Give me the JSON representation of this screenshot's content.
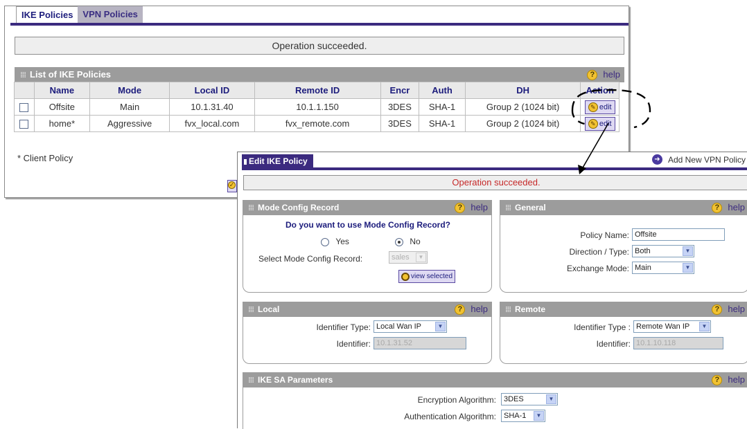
{
  "back": {
    "tabs": [
      "IKE Policies",
      "VPN Policies"
    ],
    "status": "Operation succeeded.",
    "section_title": "List of IKE Policies",
    "help": "help",
    "columns": [
      "Name",
      "Mode",
      "Local ID",
      "Remote ID",
      "Encr",
      "Auth",
      "DH",
      "Action"
    ],
    "rows": [
      {
        "name": "Offsite",
        "mode": "Main",
        "local_id": "10.1.31.40",
        "remote_id": "10.1.1.150",
        "encr": "3DES",
        "auth": "SHA-1",
        "dh": "Group 2 (1024 bit)",
        "action": "edit"
      },
      {
        "name": "home*",
        "mode": "Aggressive",
        "local_id": "fvx_local.com",
        "remote_id": "fvx_remote.com",
        "encr": "3DES",
        "auth": "SHA-1",
        "dh": "Group 2 (1024 bit)",
        "action": "edit"
      }
    ],
    "footnote": "* Client Policy"
  },
  "front": {
    "tab": "Edit IKE Policy",
    "add_new": "Add New VPN Policy",
    "status": "Operation succeeded.",
    "help": "help",
    "mode_config": {
      "title": "Mode Config Record",
      "question": "Do you want to use Mode Config Record?",
      "yes": "Yes",
      "no": "No",
      "selected": "No",
      "select_label": "Select Mode Config Record:",
      "select_value": "sales",
      "view_button": "view selected"
    },
    "general": {
      "title": "General",
      "policy_name_label": "Policy Name:",
      "policy_name_value": "Offsite",
      "direction_label": "Direction / Type:",
      "direction_value": "Both",
      "exchange_label": "Exchange Mode:",
      "exchange_value": "Main"
    },
    "local": {
      "title": "Local",
      "id_type_label": "Identifier Type:",
      "id_type_value": "Local Wan IP",
      "id_label": "Identifier:",
      "id_value": "10.1.31.52"
    },
    "remote": {
      "title": "Remote",
      "id_type_label": "Identifier Type :",
      "id_type_value": "Remote Wan IP",
      "id_label": "Identifier:",
      "id_value": "10.1.10.118"
    },
    "ike_sa": {
      "title": "IKE SA Parameters",
      "encryption_label": "Encryption Algorithm:",
      "encryption_value": "3DES",
      "auth_label": "Authentication Algorithm:",
      "auth_value": "SHA-1"
    }
  }
}
